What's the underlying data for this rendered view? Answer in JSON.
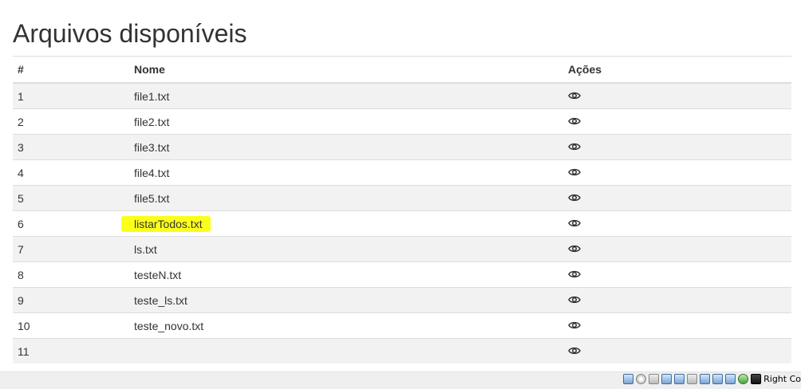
{
  "page": {
    "title": "Arquivos disponíveis"
  },
  "table": {
    "headers": {
      "num": "#",
      "name": "Nome",
      "actions": "Ações"
    },
    "rows": [
      {
        "num": "1",
        "name": "file1.txt",
        "highlighted": false
      },
      {
        "num": "2",
        "name": "file2.txt",
        "highlighted": false
      },
      {
        "num": "3",
        "name": "file3.txt",
        "highlighted": false
      },
      {
        "num": "4",
        "name": "file4.txt",
        "highlighted": false
      },
      {
        "num": "5",
        "name": "file5.txt",
        "highlighted": false
      },
      {
        "num": "6",
        "name": "listarTodos.txt",
        "highlighted": true
      },
      {
        "num": "7",
        "name": "ls.txt",
        "highlighted": false
      },
      {
        "num": "8",
        "name": "testeN.txt",
        "highlighted": false
      },
      {
        "num": "9",
        "name": "teste_ls.txt",
        "highlighted": false
      },
      {
        "num": "10",
        "name": "teste_novo.txt",
        "highlighted": false
      },
      {
        "num": "11",
        "name": "",
        "highlighted": false
      }
    ],
    "row_action_icon": "eye-icon"
  },
  "status_bar": {
    "host_key_label": "Right Co",
    "tray_icons": [
      "hard-disk-icon",
      "optical-drive-icon",
      "audio-icon",
      "network-icon",
      "usb-icon",
      "shared-folders-icon",
      "display-icon",
      "video-capture-icon",
      "recording-icon",
      "cpu-icon",
      "mouse-integration-icon",
      "keyboard-icon"
    ]
  },
  "colors": {
    "highlight": "#fbff1a",
    "stripe": "#f2f2f2",
    "border": "#dddddd"
  }
}
